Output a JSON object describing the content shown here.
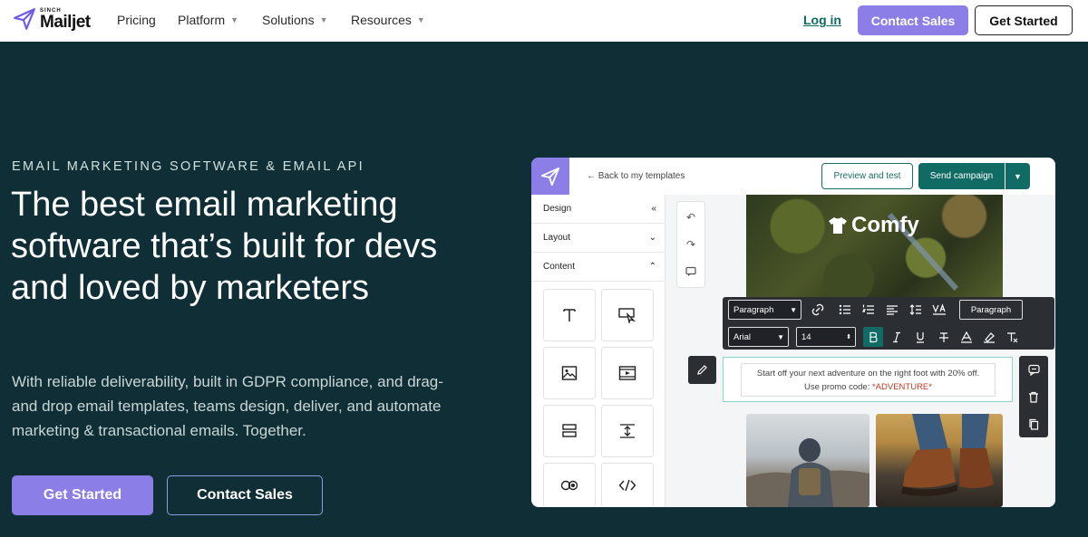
{
  "nav": {
    "logo_top": "SINCH",
    "logo_main": "Mailjet",
    "links": [
      {
        "label": "Pricing",
        "dropdown": false
      },
      {
        "label": "Platform",
        "dropdown": true
      },
      {
        "label": "Solutions",
        "dropdown": true
      },
      {
        "label": "Resources",
        "dropdown": true
      }
    ],
    "login": "Log in",
    "contact_sales": "Contact Sales",
    "get_started": "Get Started"
  },
  "hero": {
    "eyebrow": "EMAIL MARKETING SOFTWARE & EMAIL API",
    "headline": "The best email marketing software that’s built for devs and loved by marketers",
    "subtext": "With reliable deliverability, built in GDPR compliance, and drag-and drop email templates, teams design, deliver, and automate marketing & transactional emails. Together.",
    "cta_primary": "Get Started",
    "cta_secondary": "Contact Sales"
  },
  "editor": {
    "back_link": "← Back to my templates",
    "preview_button": "Preview and test",
    "send_button": "Send campaign",
    "sidebar": [
      {
        "label": "Design",
        "indicator": "«"
      },
      {
        "label": "Layout",
        "indicator": "⌄"
      },
      {
        "label": "Content",
        "indicator": "⌃"
      }
    ],
    "tile_icons": [
      "text-icon",
      "button-icon",
      "image-icon",
      "video-icon",
      "section-icon",
      "spacer-icon",
      "social-icon",
      "html-icon"
    ],
    "brand_text": "Comfy",
    "toolbar": {
      "block_type": "Paragraph",
      "font": "Arial",
      "size": "14",
      "style_button": "Paragraph"
    },
    "text_block_line1": "Start off your next adventure on the right foot with 20% off.",
    "text_block_line2_prefix": "Use promo code: ",
    "promo_code": "*ADVENTURE*"
  },
  "colors": {
    "page_bg": "#0f2e35",
    "accent_purple": "#8b7ee6",
    "accent_teal": "#0f6b63",
    "promo_red": "#c0392b"
  }
}
